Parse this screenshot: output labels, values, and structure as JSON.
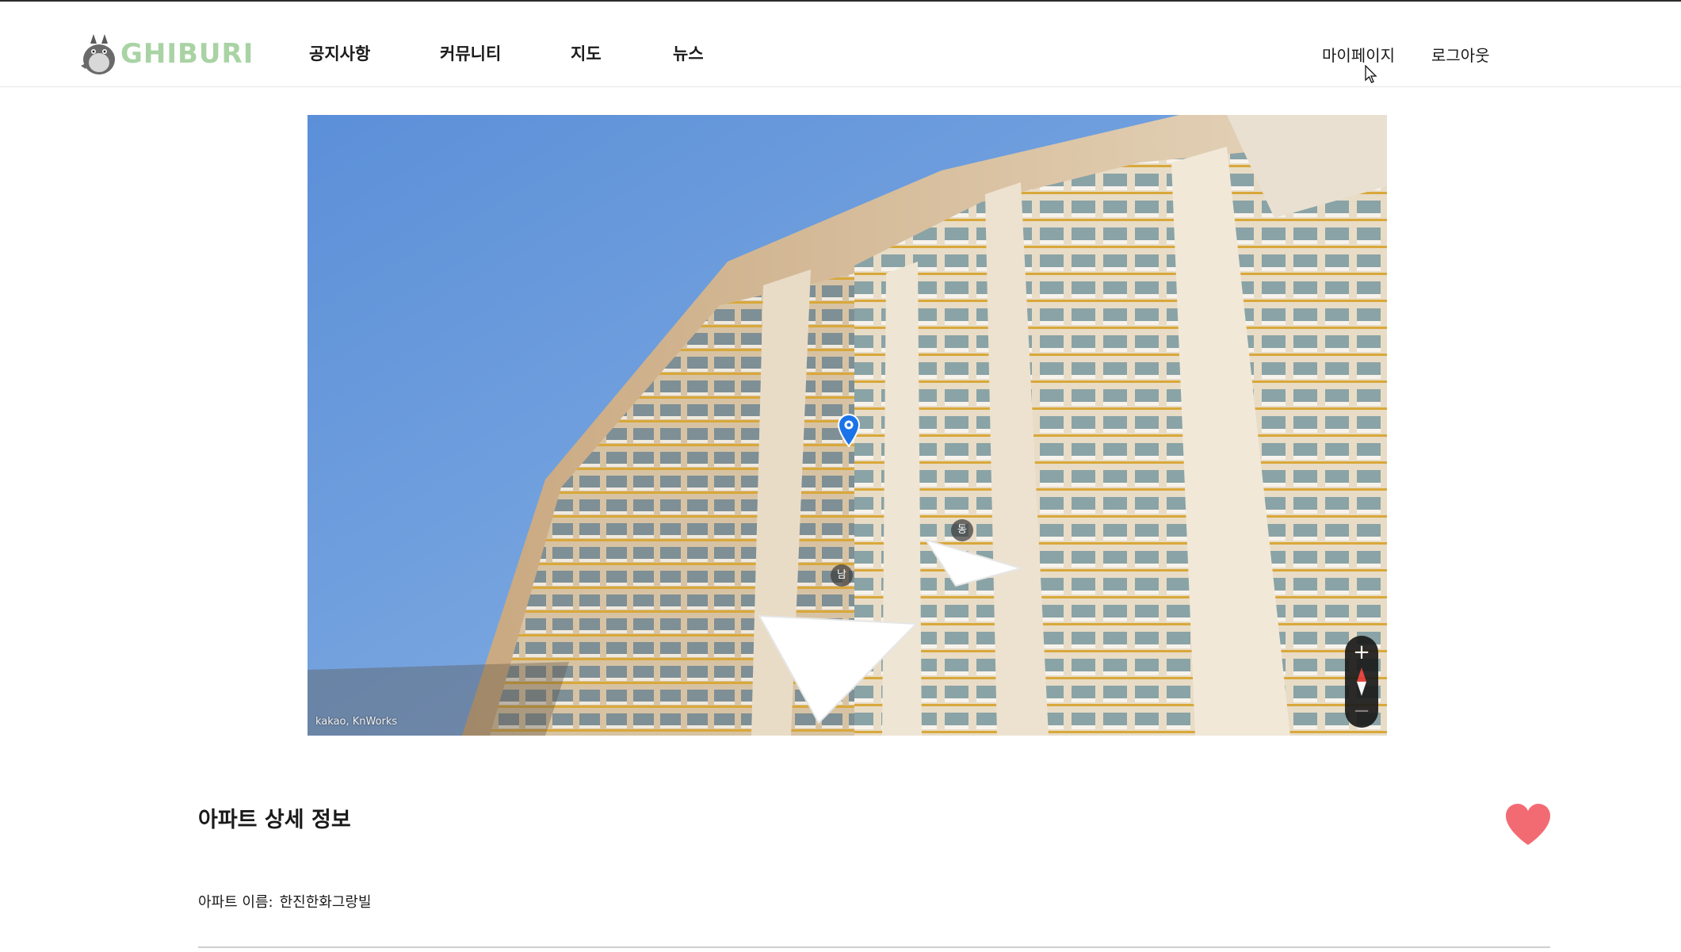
{
  "header": {
    "logo_text": "GHIBURI",
    "nav": [
      {
        "label": "공지사항"
      },
      {
        "label": "커뮤니티"
      },
      {
        "label": "지도"
      },
      {
        "label": "뉴스"
      }
    ],
    "mypage_label": "마이페이지",
    "logout_label": "로그아웃"
  },
  "roadview": {
    "copyright": "kakao, KnWorks",
    "direction_labels": {
      "south": "남",
      "east": "동"
    },
    "zoom_in_label": "+",
    "zoom_out_label": "−"
  },
  "detail": {
    "title": "아파트 상세 정보",
    "name_label": "아파트 이름:",
    "name_value": "한진한화그랑빌"
  },
  "colors": {
    "logo_green": "#a9d3a4",
    "heart": "#f26b73",
    "marker_blue": "#1a73e8"
  },
  "icons": {
    "logo": "totoro-mascot",
    "favorite": "heart-icon",
    "marker": "location-pin-icon",
    "compass": "compass-icon"
  }
}
